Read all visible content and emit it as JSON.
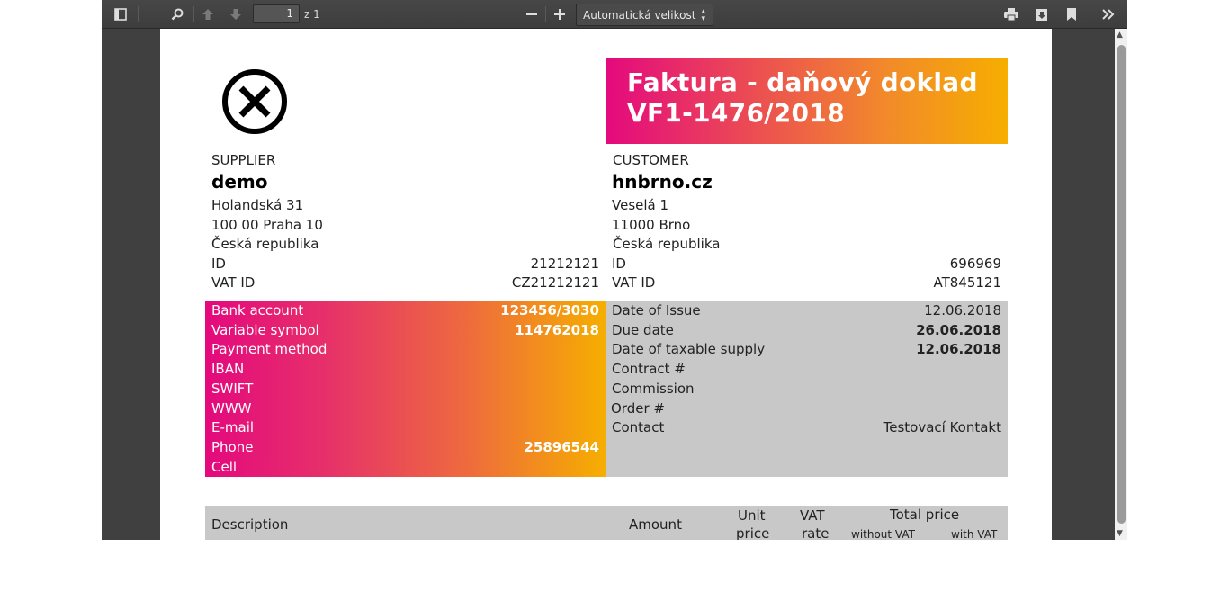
{
  "toolbar": {
    "page_number": "1",
    "page_total": "z 1",
    "zoom_value": "Automatická velikost",
    "icons": [
      "sidebar-toggle-icon",
      "search-icon",
      "previous-page-icon",
      "next-page-icon",
      "zoom-out-icon",
      "zoom-in-icon",
      "print-icon",
      "download-icon",
      "bookmark-icon",
      "tools-icon"
    ]
  },
  "invoice": {
    "title_line1": "Faktura - daňový doklad",
    "title_line2": "VF1-1476/2018",
    "supplier": {
      "label": "SUPPLIER",
      "name": "demo",
      "street": "Holandská 31",
      "city": "100 00   Praha 10",
      "country": "Česká republika",
      "id_label": "ID",
      "id_value": "21212121",
      "vat_label": "VAT ID",
      "vat_value": "CZ21212121"
    },
    "customer": {
      "label": "CUSTOMER",
      "name": "hnbrno.cz",
      "street": "Veselá 1",
      "city": "11000   Brno",
      "country": "Česká republika",
      "id_label": "ID",
      "id_value": "696969",
      "vat_label": "VAT ID",
      "vat_value": "AT845121"
    },
    "payment": [
      {
        "label": "Bank account",
        "value": "123456/3030"
      },
      {
        "label": "Variable symbol",
        "value": "114762018"
      },
      {
        "label": "Payment method",
        "value": ""
      },
      {
        "label": "IBAN",
        "value": ""
      },
      {
        "label": "SWIFT",
        "value": ""
      },
      {
        "label": "WWW",
        "value": ""
      },
      {
        "label": "E-mail",
        "value": ""
      },
      {
        "label": "Phone",
        "value": "25896544"
      },
      {
        "label": "Cell",
        "value": ""
      }
    ],
    "dates": [
      {
        "label": "Date of Issue",
        "value": "12.06.2018",
        "bold": false
      },
      {
        "label": "Due date",
        "value": "26.06.2018",
        "bold": true
      },
      {
        "label": "Date of taxable supply",
        "value": "12.06.2018",
        "bold": true
      },
      {
        "label": "Contract #",
        "value": "",
        "bold": false
      },
      {
        "label": "Commission",
        "value": "",
        "bold": false
      },
      {
        "label": "Order #",
        "value": "",
        "bold": false
      },
      {
        "label": "Contact",
        "value": "Testovací Kontakt",
        "bold": false
      }
    ],
    "table_header": {
      "description": "Description",
      "amount": "Amount",
      "unit_price": "Unit price",
      "unit_price_l1": "Unit",
      "unit_price_l2": "price",
      "vat_rate_l1": "VAT",
      "vat_rate_l2": "rate",
      "total_price": "Total price",
      "without_vat": "without VAT",
      "with_vat": "with VAT"
    }
  },
  "colors": {
    "toolbar_bg": "#474747",
    "viewer_bg": "#404040",
    "accent_start": "#e4097e",
    "accent_end": "#f6ae00",
    "grey_panel": "#c8c8c8"
  }
}
